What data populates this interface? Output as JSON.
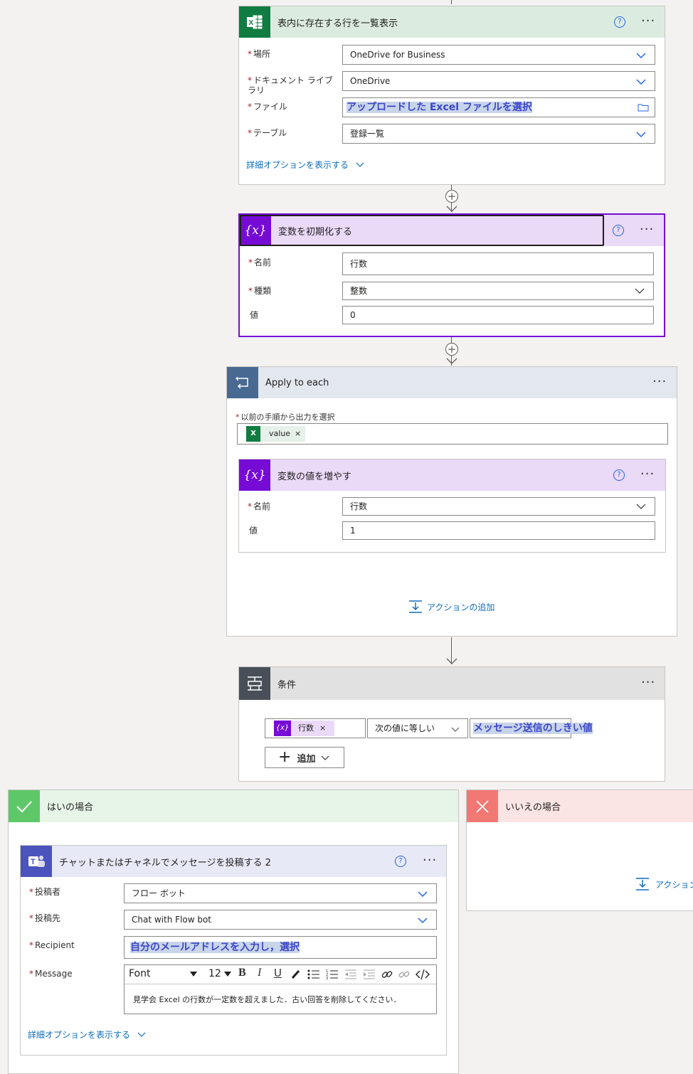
{
  "list_rows": {
    "title": "表内に存在する行を一覧表示",
    "help": "?",
    "more": "···",
    "location_label": "場所",
    "location_value": "OneDrive for Business",
    "library_label_l1": "ドキュメント ライブ",
    "library_label_l2": "ラリ",
    "library_value": "OneDrive",
    "file_label": "ファイル",
    "file_value": "アップロードした Excel ファイルを選択",
    "table_label": "テーブル",
    "table_value": "登録一覧",
    "advanced": "詳細オプションを表示する"
  },
  "init_var": {
    "title": "変数を初期化する",
    "icon": "{x}",
    "help": "?",
    "more": "···",
    "name_label": "名前",
    "name_value": "行数",
    "type_label": "種類",
    "type_value": "整数",
    "value_label": "値",
    "value_value": "0"
  },
  "apply_each": {
    "title": "Apply to each",
    "more": "···",
    "select_label": "以前の手順から出力を選択",
    "token": "value",
    "token_close": "×",
    "add_action": "アクションの追加"
  },
  "increment": {
    "title": "変数の値を増やす",
    "icon": "{x}",
    "help": "?",
    "more": "···",
    "name_label": "名前",
    "name_value": "行数",
    "value_label": "値",
    "value_value": "1"
  },
  "condition": {
    "title": "条件",
    "more": "···",
    "token_icon": "{x}",
    "token": "行数",
    "token_close": "×",
    "operator": "次の値に等しい",
    "value": "メッセージ送信のしきい値",
    "add_button": "追加",
    "add_plus": "+"
  },
  "yes_branch": {
    "title": "はいの場合"
  },
  "no_branch": {
    "title": "いいえの場合",
    "add_action": "アクション"
  },
  "teams": {
    "title": "チャットまたはチャネルでメッセージを投稿する 2",
    "help": "?",
    "more": "···",
    "poster_label": "投稿者",
    "poster_value": "フロー ボット",
    "post_in_label": "投稿先",
    "post_in_value": "Chat with Flow bot",
    "recipient_label": "Recipient",
    "recipient_value": "自分のメールアドレスを入力し，選択",
    "message_label": "Message",
    "font": "Font",
    "font_size": "12",
    "message_text": "見学会 Excel の行数が一定数を超えました．古い回答を削除してください．",
    "advanced": "詳細オプションを表示する"
  },
  "colors": {
    "excel_green": "#107c41",
    "variable_purple": "#770bd6",
    "loop_blue": "#486991",
    "condition_gray": "#484f58",
    "teams_indigo": "#4b53bc",
    "yes_green": "#5ec869",
    "no_red": "#f27873",
    "link_blue": "#0f6cbd"
  }
}
